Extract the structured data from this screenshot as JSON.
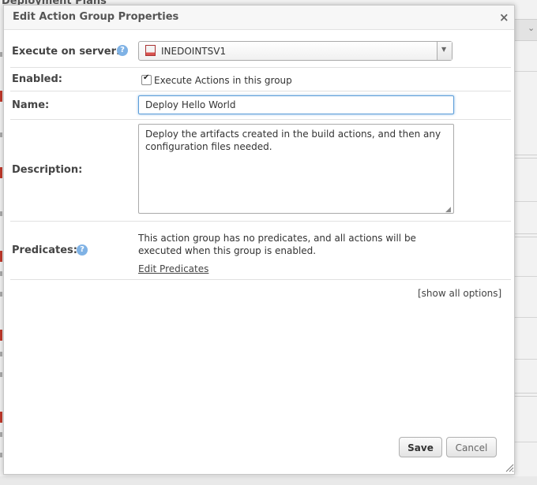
{
  "background": {
    "page_title": "Deployment Plans"
  },
  "dialog": {
    "title": "Edit Action Group Properties",
    "close_glyph": "×"
  },
  "fields": {
    "server": {
      "label": "Execute on server:",
      "help_glyph": "?",
      "value": "INEDOINTSV1",
      "icon": "server-icon"
    },
    "enabled": {
      "label": "Enabled:",
      "checked": true,
      "checkbox_label": "Execute Actions in this group"
    },
    "name": {
      "label": "Name:",
      "value": "Deploy Hello World"
    },
    "description": {
      "label": "Description:",
      "value": "Deploy the artifacts created in the build actions, and then any configuration files needed."
    },
    "predicates": {
      "label": "Predicates:",
      "help_glyph": "?",
      "text": "This action group has no predicates, and all actions will be executed when this group is enabled.",
      "link": "Edit Predicates"
    }
  },
  "options": {
    "show_all": "[show all options]"
  },
  "buttons": {
    "save": "Save",
    "cancel": "Cancel"
  },
  "colors": {
    "help_icon": "#7fb2e5",
    "focus_border": "#5b9dd9",
    "server_icon_red": "#d9534f"
  }
}
